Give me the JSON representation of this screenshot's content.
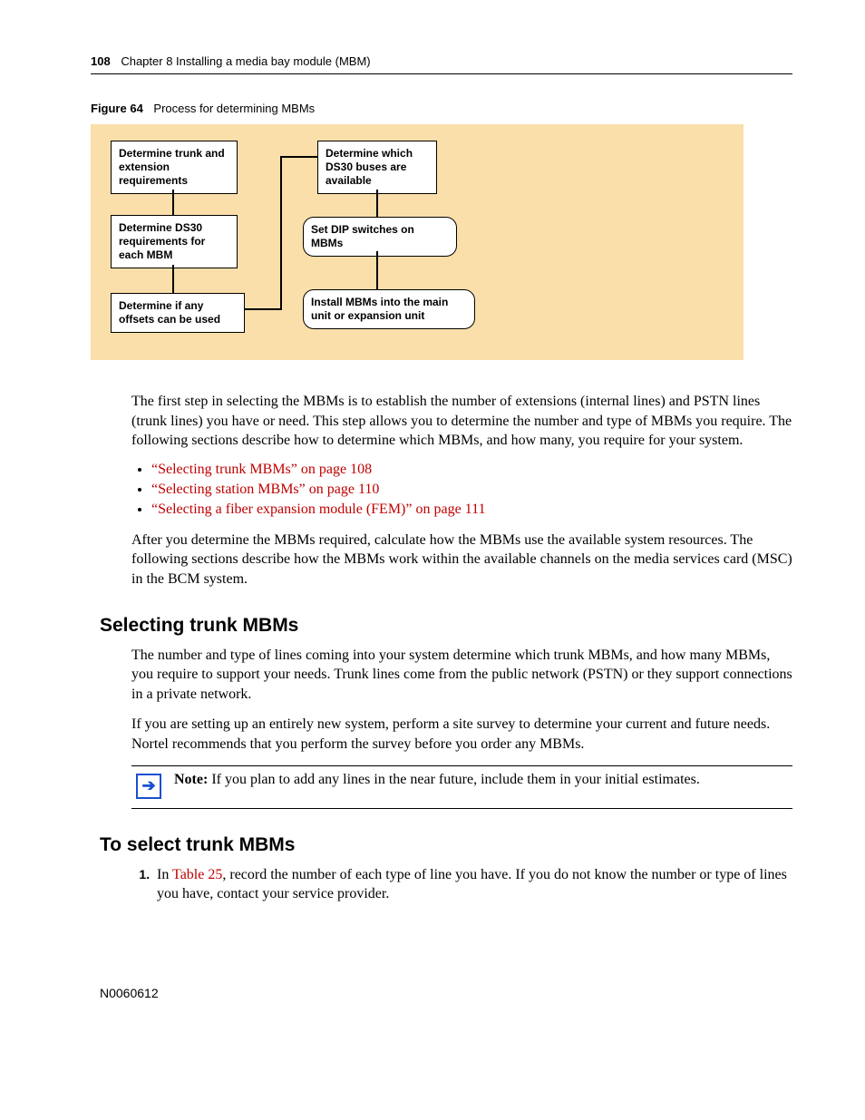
{
  "header": {
    "pageno": "108",
    "chapter": "Chapter 8  Installing a media bay module (MBM)"
  },
  "figure": {
    "label": "Figure 64",
    "caption": "Process for determining MBMs",
    "boxes": {
      "b1": "Determine trunk and extension requirements",
      "b2": "Determine DS30 requirements for each MBM",
      "b3": "Determine if any offsets can be used",
      "b4": "Determine which DS30 buses are available",
      "b5": "Set DIP switches on MBMs",
      "b6": "Install MBMs into the main unit or expansion unit"
    }
  },
  "para1": "The first step in selecting the MBMs is to establish the number of extensions (internal lines) and PSTN lines (trunk lines) you have or need. This step allows you to determine the number and type of MBMs you require. The following sections describe how to determine which MBMs, and how many, you require for your system.",
  "links": [
    "“Selecting trunk MBMs” on page 108",
    "“Selecting station MBMs” on page 110",
    "“Selecting a fiber expansion module (FEM)” on page 111"
  ],
  "para2": "After you determine the MBMs required, calculate how the MBMs use the available system resources. The following sections describe how the MBMs work within the available channels on the media services card (MSC) in the BCM system.",
  "section1": {
    "title": "Selecting trunk MBMs",
    "p1": "The number and type of lines coming into your system determine which trunk MBMs, and how many MBMs, you require to support your needs. Trunk lines come from the public network (PSTN) or they support connections in a private network.",
    "p2": "If you are setting up an entirely new system, perform a site survey to determine your current and future needs. Nortel recommends that you perform the survey before you order any MBMs."
  },
  "note": {
    "label": "Note:",
    "text": " If you plan to add any lines in the near future, include them in your initial estimates."
  },
  "section2": {
    "title": "To select trunk MBMs",
    "step_prefix": "In ",
    "step_link": "Table 25",
    "step_rest": ", record the number of each type of line you have. If you do not know the number or type of lines you have, contact your service provider."
  },
  "footer": "N0060612",
  "icons": {
    "arrow": "➔"
  }
}
